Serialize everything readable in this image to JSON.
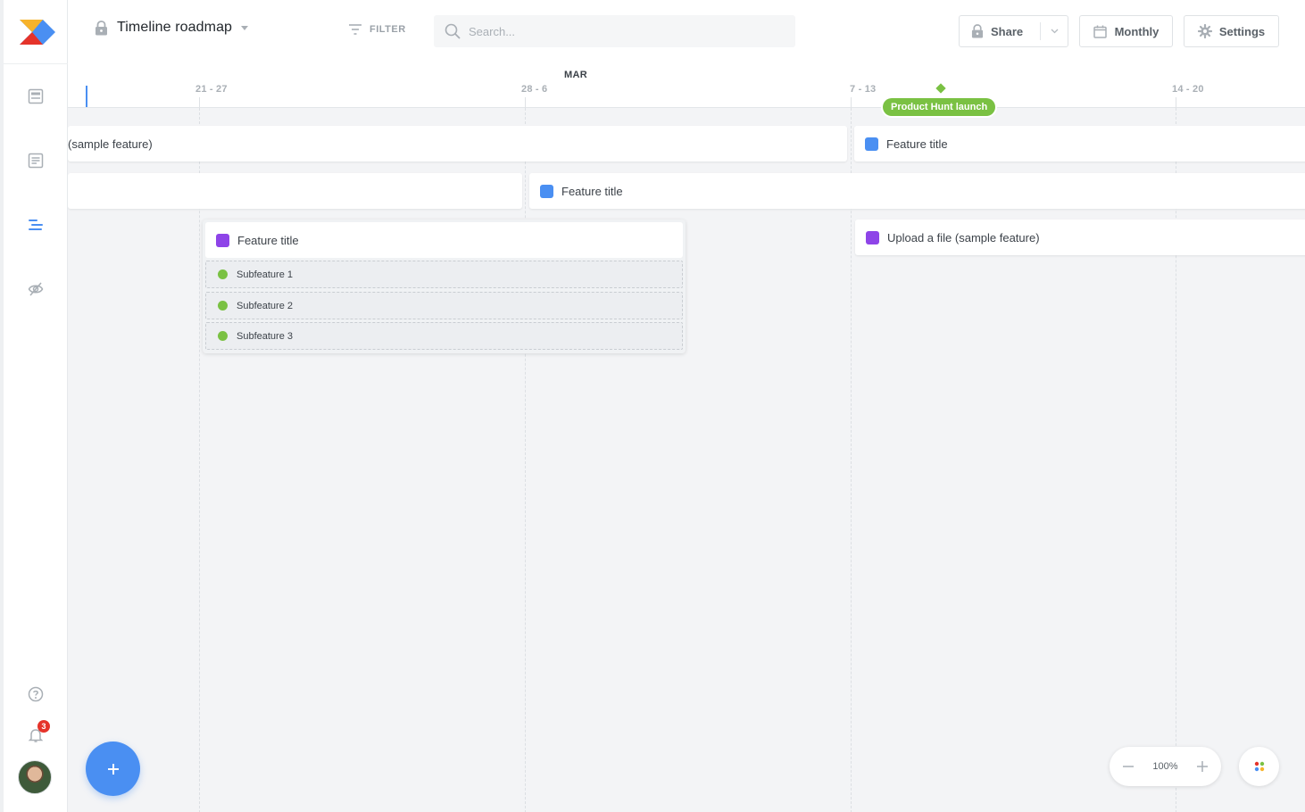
{
  "header": {
    "title": "Timeline roadmap",
    "filter_label": "FILTER",
    "search_placeholder": "Search...",
    "share_label": "Share",
    "monthly_label": "Monthly",
    "settings_label": "Settings"
  },
  "timeline": {
    "month": "MAR",
    "weeks": [
      "21 - 27",
      "28 - 6",
      "7 - 13",
      "14 - 20"
    ],
    "milestone": {
      "label": "Product Hunt launch",
      "color": "#7ac143"
    },
    "bars": [
      {
        "title": "(sample feature)",
        "color": null
      },
      {
        "title": "Feature title",
        "color": "#4a8ff2"
      },
      {
        "title": "",
        "color": null
      },
      {
        "title": "Feature title",
        "color": "#4a8ff2"
      },
      {
        "title": "Upload a file (sample feature)",
        "color": "#8e44e8"
      }
    ],
    "group": {
      "title": "Feature title",
      "color": "#8e44e8",
      "subfeatures": [
        "Subfeature 1",
        "Subfeature 2",
        "Subfeature 3"
      ],
      "subfeature_color": "#7ac143"
    }
  },
  "zoom": {
    "level": "100%"
  },
  "notifications": {
    "count": "3"
  },
  "colors": {
    "accent": "#4a8ff2",
    "success": "#7ac143",
    "purple": "#8e44e8",
    "alert": "#e5332a"
  }
}
